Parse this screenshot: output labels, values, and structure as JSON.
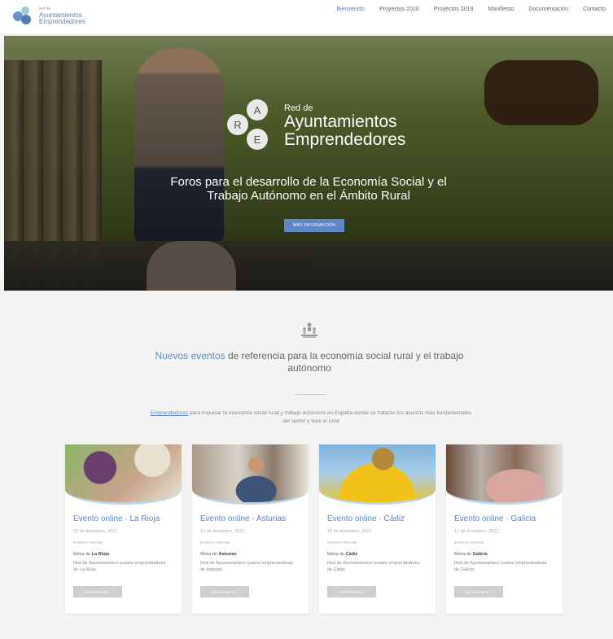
{
  "header": {
    "logo_small": "red de",
    "logo_line1": "Ayuntamientos",
    "logo_line2": "Emprendedores",
    "nav": [
      "Bienvenido",
      "Proyectos 2020",
      "Proyectos 2019",
      "Manifiesto",
      "Documentación",
      "Contacto"
    ],
    "active_index": 0,
    "accent": "#5d86c9"
  },
  "hero": {
    "brand_small": "Red de",
    "brand_line1": "Ayuntamientos",
    "brand_line2": "Emprendedores",
    "badge_r": "R",
    "badge_a": "A",
    "badge_e": "E",
    "title_line1": "Foros para el desarrollo de la Economía Social y el",
    "title_line2": "Trabajo Autónomo en el Ámbito Rural",
    "button": "MÁS INFORMACIÓN"
  },
  "intro": {
    "icon": "community-icon",
    "heading_highlight": "Nuevos eventos",
    "heading_rest": " de referencia para la economía social rural y el trabajo autónomo",
    "link_text": "Emprendedores",
    "text_rest": " para impulsar la economía social rural y trabajo autónomo en España donde se tratarán los asuntos más fundamentales del sector y tope el rural"
  },
  "cards": [
    {
      "title": "Evento online · La Rioja",
      "date": "03 de diciembre, 2021",
      "type": "Evento online",
      "org_label": "Mesa de ",
      "org_place": "La Rioja",
      "org_text": "Red de Ayuntamientos rurales emprendedores de La Rioja",
      "button": "INSCRÍBETE ›"
    },
    {
      "title": "Evento online · Asturias",
      "date": "10 de diciembre, 2021",
      "type": "Evento online",
      "org_label": "Mesa de ",
      "org_place": "Asturias",
      "org_text": "Red de Ayuntamientos rurales emprendedores de Asturias",
      "button": "INSCRÍBETE ›"
    },
    {
      "title": "Evento online · Cádiz",
      "date": "15 de diciembre, 2021",
      "type": "Evento online",
      "org_label": "Mesa de ",
      "org_place": "Cádiz",
      "org_text": "Red de Ayuntamientos rurales emprendedores de Cádiz",
      "button": "INSCRÍBETE ›"
    },
    {
      "title": "Evento online · Galicia",
      "date": "17 de diciembre, 2021",
      "type": "Evento online",
      "org_label": "Mesa de ",
      "org_place": "Galicia",
      "org_text": "Red de Ayuntamientos rurales emprendedores de Galicia",
      "button": "INSCRÍBETE ›"
    }
  ]
}
